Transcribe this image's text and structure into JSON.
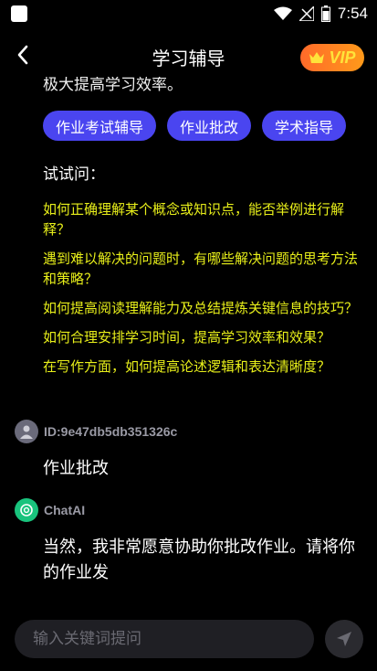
{
  "status_bar": {
    "time": "7:54"
  },
  "nav": {
    "title": "学习辅导",
    "vip_label": "VIP"
  },
  "intro": {
    "truncated_text": "极大提高学习效率。"
  },
  "chips": [
    "作业考试辅导",
    "作业批改",
    "学术指导"
  ],
  "try_ask": {
    "label": "试试问：",
    "suggestions": [
      "如何正确理解某个概念或知识点，能否举例进行解释？",
      "遇到难以解决的问题时，有哪些解决问题的思考方法和策略？",
      "如何提高阅读理解能力及总结提炼关键信息的技巧？",
      "如何合理安排学习时间，提高学习效率和效果？",
      "在写作方面，如何提高论述逻辑和表达清晰度？"
    ]
  },
  "messages": [
    {
      "author": "ID:9e47db5db351326c",
      "text": "作业批改"
    },
    {
      "author": "ChatAI",
      "text": "当然，我非常愿意协助你批改作业。请将你的作业发"
    }
  ],
  "input": {
    "placeholder": "输入关键词提问",
    "value": ""
  },
  "colors": {
    "chip": "#4a45f0",
    "suggestion": "#e8ef1a",
    "vip": "#ff7a22",
    "ai_avatar": "#19c37d"
  }
}
